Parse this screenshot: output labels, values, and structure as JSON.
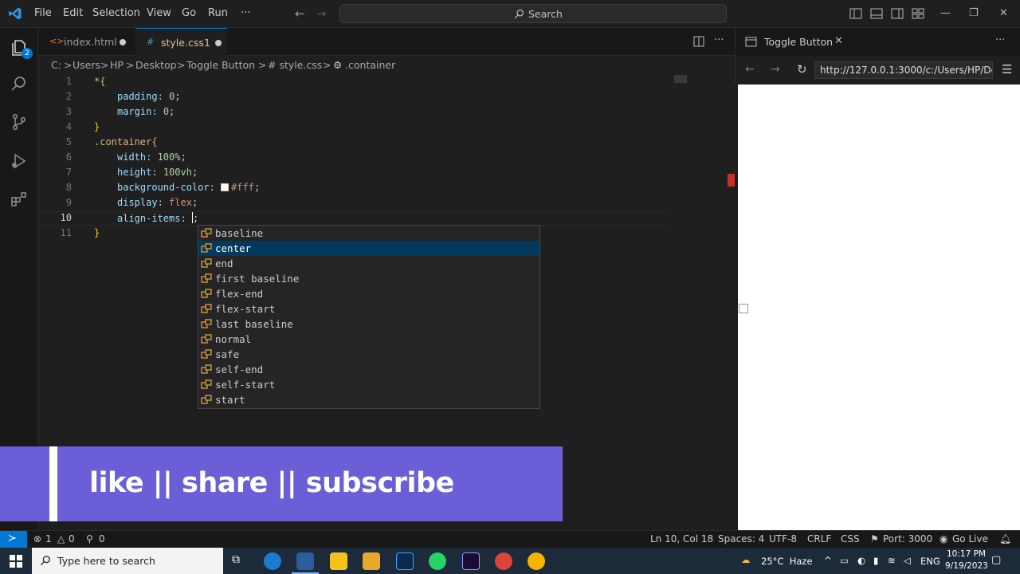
{
  "menu": [
    "File",
    "Edit",
    "Selection",
    "View",
    "Go",
    "Run",
    "···"
  ],
  "search": {
    "label": "Search"
  },
  "tabs": [
    {
      "label": "index.html",
      "icon": "<>"
    },
    {
      "label": "style.css",
      "icon": "#",
      "problems": "1"
    }
  ],
  "breadcrumb": [
    "C:",
    ">",
    "Users",
    ">",
    "HP",
    ">",
    "Desktop",
    ">",
    "Toggle Button",
    ">",
    "# style.css",
    ">",
    ".container"
  ],
  "code": {
    "lines": [
      "1",
      "2",
      "3",
      "4",
      "5",
      "6",
      "7",
      "8",
      "9",
      "10",
      "11"
    ],
    "l1": "*{",
    "l2_prop": "padding",
    "l2_val": "0",
    "l3_prop": "margin",
    "l3_val": "0",
    "l4": "}",
    "l5": ".container{",
    "l6_prop": "width",
    "l6_val": "100%",
    "l7_prop": "height",
    "l7_val": "100vh",
    "l8_prop": "background-color",
    "l8_val": "#fff",
    "l9_prop": "display",
    "l9_val": "flex",
    "l10_prop": "align-items",
    "l11": "}"
  },
  "suggestions": [
    "baseline",
    "center",
    "end",
    "first baseline",
    "flex-end",
    "flex-start",
    "last baseline",
    "normal",
    "safe",
    "self-end",
    "self-start",
    "start"
  ],
  "preview": {
    "tab": "Toggle Button",
    "url": "http://127.0.0.1:3000/c:/Users/HP/De"
  },
  "banner": {
    "text": "like || share || subscribe"
  },
  "status": {
    "errors": "1",
    "warnings": "0",
    "ports_count": "0",
    "position": "Ln 10, Col 18",
    "spaces": "Spaces: 4",
    "encoding": "UTF-8",
    "eol": "CRLF",
    "language": "CSS",
    "port": "Port: 3000",
    "golive": "Go Live"
  },
  "taskbar": {
    "search_placeholder": "Type here to search",
    "weather": "25°C  Haze",
    "lang": "ENG",
    "time": "10:17 PM",
    "date": "9/19/2023"
  },
  "colors": {
    "accent": "#0078d4",
    "banner": "#6a5fd6",
    "selection": "#04395e"
  }
}
